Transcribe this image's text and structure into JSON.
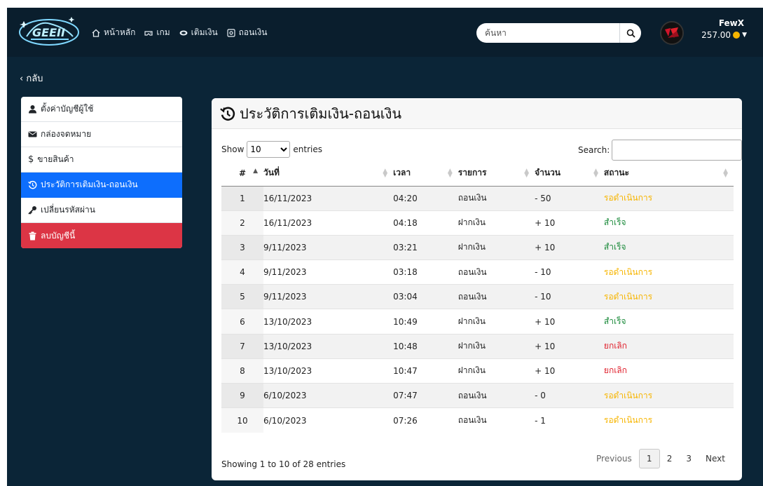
{
  "nav": {
    "links": [
      {
        "label": "หน้าหลัก",
        "icon": "home-icon"
      },
      {
        "label": "เกม",
        "icon": "gamepad-icon"
      },
      {
        "label": "เติมเงิน",
        "icon": "wallet-icon"
      },
      {
        "label": "ถอนเงิน",
        "icon": "cash-out-icon"
      }
    ],
    "search_placeholder": "ค้นหา",
    "user_name": "FewX",
    "balance": "257.00"
  },
  "back_label": "กลับ",
  "sidebar": {
    "items": [
      {
        "label": "ตั้งค่าบัญชีผู้ใช้",
        "icon": "user-icon"
      },
      {
        "label": "กล่องจดหมาย",
        "icon": "envelope-icon"
      },
      {
        "label": "ขายสินค้า",
        "icon": "dollar-icon"
      },
      {
        "label": "ประวัติการเติมเงิน-ถอนเงิน",
        "icon": "history-icon"
      },
      {
        "label": "เปลี่ยนรหัสผ่าน",
        "icon": "key-icon"
      },
      {
        "label": "ลบบัญชีนี้",
        "icon": "trash-icon"
      }
    ]
  },
  "panel": {
    "title": "ประวัติการเติมเงิน-ถอนเงิน",
    "show_label": "Show",
    "page_length": "10",
    "entries_label": "entries",
    "search_label": "Search:",
    "columns": [
      "#",
      "วันที่",
      "เวลา",
      "รายการ",
      "จำนวน",
      "สถานะ"
    ],
    "rows": [
      {
        "no": "1",
        "date": "16/11/2023",
        "time": "04:20",
        "type": "ถอนเงิน",
        "amount": "- 50",
        "status": "รอดำเนินการ",
        "status_kind": "pending"
      },
      {
        "no": "2",
        "date": "16/11/2023",
        "time": "04:18",
        "type": "ฝากเงิน",
        "amount": "+ 10",
        "status": "สำเร็จ",
        "status_kind": "ok"
      },
      {
        "no": "3",
        "date": "9/11/2023",
        "time": "03:21",
        "type": "ฝากเงิน",
        "amount": "+ 10",
        "status": "สำเร็จ",
        "status_kind": "ok"
      },
      {
        "no": "4",
        "date": "9/11/2023",
        "time": "03:18",
        "type": "ถอนเงิน",
        "amount": "- 10",
        "status": "รอดำเนินการ",
        "status_kind": "pending"
      },
      {
        "no": "5",
        "date": "9/11/2023",
        "time": "03:04",
        "type": "ถอนเงิน",
        "amount": "- 10",
        "status": "รอดำเนินการ",
        "status_kind": "pending"
      },
      {
        "no": "6",
        "date": "13/10/2023",
        "time": "10:49",
        "type": "ฝากเงิน",
        "amount": "+ 10",
        "status": "สำเร็จ",
        "status_kind": "ok"
      },
      {
        "no": "7",
        "date": "13/10/2023",
        "time": "10:48",
        "type": "ฝากเงิน",
        "amount": "+ 10",
        "status": "ยกเลิก",
        "status_kind": "cancel"
      },
      {
        "no": "8",
        "date": "13/10/2023",
        "time": "10:47",
        "type": "ฝากเงิน",
        "amount": "+ 10",
        "status": "ยกเลิก",
        "status_kind": "cancel"
      },
      {
        "no": "9",
        "date": "6/10/2023",
        "time": "07:47",
        "type": "ถอนเงิน",
        "amount": "- 0",
        "status": "รอดำเนินการ",
        "status_kind": "pending"
      },
      {
        "no": "10",
        "date": "6/10/2023",
        "time": "07:26",
        "type": "ถอนเงิน",
        "amount": "- 1",
        "status": "รอดำเนินการ",
        "status_kind": "pending"
      }
    ],
    "info": "Showing 1 to 10 of 28 entries",
    "pager": {
      "previous": "Previous",
      "pages": [
        "1",
        "2",
        "3"
      ],
      "current": "1",
      "next": "Next"
    }
  },
  "colors": {
    "background": "#0b2537",
    "navbar": "#0a1e2d",
    "active": "#0d6efd",
    "danger": "#dc3545",
    "pending": "#f7b500",
    "ok": "#1a8a3a",
    "cancel": "#e0202c"
  }
}
